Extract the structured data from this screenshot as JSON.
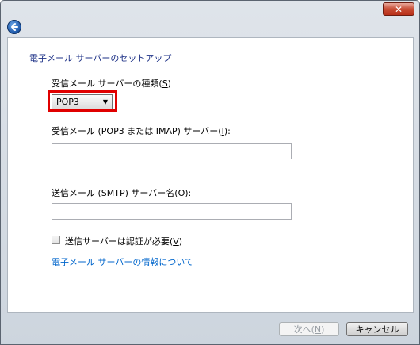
{
  "titlebar": {
    "close_label": "✕"
  },
  "heading": "電子メール サーバーのセットアップ",
  "incoming_type": {
    "label_prefix": "受信メール サーバーの種類(",
    "accesskey": "S",
    "label_suffix": ")",
    "selected": "POP3",
    "highlight_color": "#e00000"
  },
  "incoming_server": {
    "label_prefix": "受信メール (POP3 または IMAP) サーバー(",
    "accesskey": "I",
    "label_suffix": "):",
    "value": ""
  },
  "outgoing_server": {
    "label_prefix": "送信メール (SMTP) サーバー名(",
    "accesskey": "O",
    "label_suffix": "):",
    "value": ""
  },
  "auth_checkbox": {
    "label_prefix": "送信サーバーは認証が必要(",
    "accesskey": "V",
    "label_suffix": ")",
    "checked": false
  },
  "info_link": "電子メール サーバーの情報について",
  "footer": {
    "next_prefix": "次へ(",
    "next_accesskey": "N",
    "next_suffix": ")",
    "cancel_label": "キャンセル"
  }
}
